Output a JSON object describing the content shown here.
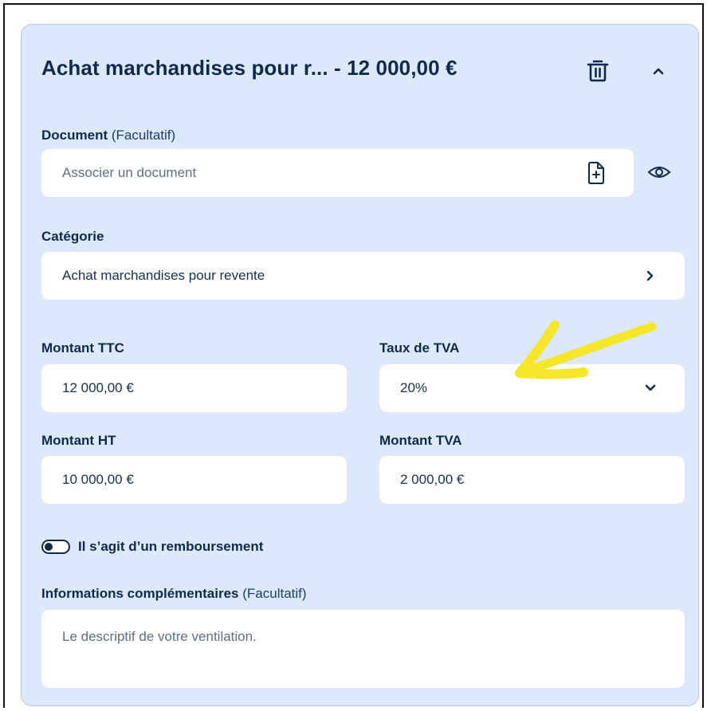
{
  "header": {
    "title": "Achat marchandises pour r... - 12 000,00 €"
  },
  "document": {
    "label": "Document",
    "optional": "(Facultatif)",
    "placeholder": "Associer un document"
  },
  "category": {
    "label": "Catégorie",
    "value": "Achat marchandises pour revente"
  },
  "amount_ttc": {
    "label": "Montant TTC",
    "value": "12 000,00 €"
  },
  "vat_rate": {
    "label": "Taux de TVA",
    "value": "20%"
  },
  "amount_ht": {
    "label": "Montant HT",
    "value": "10 000,00 €"
  },
  "amount_vat": {
    "label": "Montant TVA",
    "value": "2 000,00 €"
  },
  "refund_toggle": {
    "label": "Il s’agit d’un remboursement"
  },
  "extra_info": {
    "label": "Informations complémentaires",
    "optional": "(Facultatif)",
    "placeholder": "Le descriptif de votre ventilation."
  },
  "colors": {
    "card_background": "#dce8fb",
    "text_primary": "#102a4c",
    "annotation_arrow": "#f5e62a"
  },
  "icons": [
    "trash-icon",
    "chevron-up-icon",
    "file-add-icon",
    "eye-icon",
    "chevron-right-icon",
    "chevron-down-icon"
  ]
}
